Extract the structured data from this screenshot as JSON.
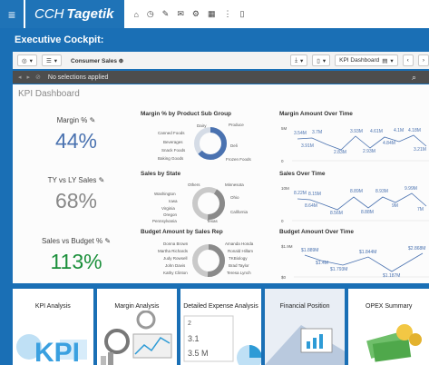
{
  "app": {
    "brand_left": "CCH",
    "brand_right": "Tagetik"
  },
  "header": {
    "title": "Executive Cockpit:"
  },
  "toolbar": {
    "filter_label": "Consumer Sales",
    "kpi_dashboard": "KPI Dashboard"
  },
  "selections": {
    "text": "No selections applied"
  },
  "dashboard": {
    "title": "KPI Dashboard",
    "kpis": [
      {
        "label": "Margin %",
        "value": "44%",
        "color": "#4a72b0"
      },
      {
        "label": "TY vs LY Sales",
        "value": "68%",
        "color": "#888888"
      },
      {
        "label": "Sales vs Budget %",
        "value": "113%",
        "color": "#1a8f3a"
      }
    ]
  },
  "charts": {
    "margin_sub_group": {
      "title": "Margin % by Product Sub Group",
      "labels": [
        "Dairy",
        "Produce",
        "Canned Foods",
        "Beverages",
        "Snack Foods",
        "Baking Goods",
        "Deli",
        "Frozen Foods"
      ]
    },
    "sales_by_state": {
      "title": "Sales by State",
      "labels": [
        "Others",
        "Minnesota",
        "Washington",
        "Iowa",
        "Virginia",
        "Oregon",
        "Pennsylvania",
        "Texas",
        "California",
        "Ohio"
      ]
    },
    "budget_by_rep": {
      "title": "Budget Amount by Sales Rep",
      "labels": [
        "Donna Brown",
        "Martha Richards",
        "Judy Rowsell",
        "John Davis",
        "Kathy Clinton",
        "Amanda Honda",
        "Ronald Hillam",
        "TKBiology",
        "Brad Taylor",
        "Teresa Lynch"
      ]
    },
    "margin_over_time": {
      "title": "Margin Amount Over Time",
      "axis": [
        "5M",
        "0"
      ],
      "points": [
        "3.54M",
        "3.7M",
        "3.91M",
        "2.83M",
        "3.93M",
        "2.93M",
        "4.61M",
        "4.84M",
        "4.1M",
        "4.18M",
        "3.21M"
      ]
    },
    "sales_over_time": {
      "title": "Sales Over Time",
      "axis": [
        "10M",
        "0"
      ],
      "points": [
        "8.22M",
        "8.15M",
        "8.64M",
        "8.56M",
        "8.89M",
        "8.88M",
        "8.93M",
        "9M",
        "9.99M",
        "7M"
      ]
    },
    "budget_over_time": {
      "title": "Budget Amount Over Time",
      "axis": [
        "$1.9M",
        "$0"
      ],
      "points": [
        "$1.889M",
        "$1.4M",
        "$1.793M",
        "$1.844M",
        "$1.187M",
        "$2.868M"
      ]
    }
  },
  "tiles": [
    {
      "label": "KPI Analysis"
    },
    {
      "label": "Margin Analysis"
    },
    {
      "label": "Detailed Expense Analysis"
    },
    {
      "label": "Financial Position"
    },
    {
      "label": "OPEX Summary"
    }
  ],
  "tile_art": {
    "value_a": "2",
    "value_b": "3.1",
    "value_c": "3.5 M"
  },
  "colors": {
    "brand_blue": "#1f73b7",
    "background_blue": "#1a6fb5",
    "selbar": "#4d4d4d"
  }
}
